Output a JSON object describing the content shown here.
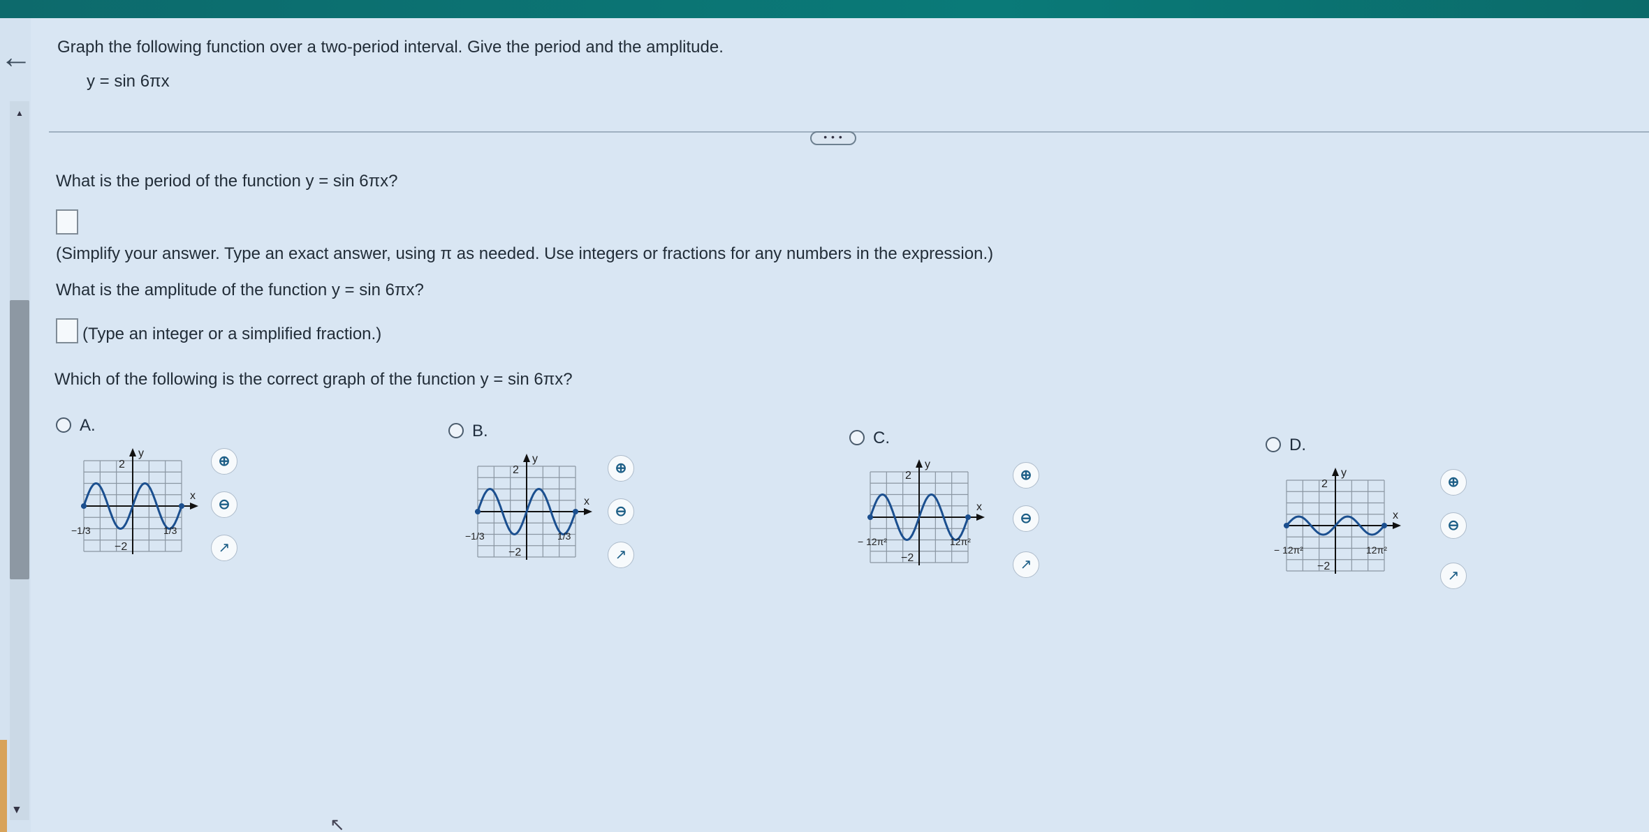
{
  "problem": {
    "prompt": "Graph the following function over a two-period interval. Give the period and the amplitude.",
    "function": "y = sin 6πx"
  },
  "more_pill": "• • •",
  "questions": {
    "period": "What is the period of the function y = sin 6πx?",
    "period_hint": "(Simplify your answer. Type an exact answer, using π as needed. Use integers or fractions for any numbers in the expression.)",
    "amplitude": "What is the amplitude of the function y = sin 6πx?",
    "amplitude_hint": "(Type an integer or a simplified fraction.)",
    "graph": "Which of the following is the correct graph of the function y = sin 6πx?"
  },
  "answers": {
    "period_value": "",
    "amplitude_value": ""
  },
  "options": [
    {
      "label": "A.",
      "xmin_label": "−1/3",
      "xmax_label": "1/3",
      "ymax_label": "2",
      "ymin_label": "−2",
      "x_axis": "x",
      "y_axis": "y"
    },
    {
      "label": "B.",
      "xmin_label": "−1/3",
      "xmax_label": "1/3",
      "ymax_label": "2",
      "ymin_label": "−2",
      "x_axis": "x",
      "y_axis": "y"
    },
    {
      "label": "C.",
      "xmin_label": "− 12π²",
      "xmax_label": "12π²",
      "ymax_label": "2",
      "ymin_label": "−2",
      "x_axis": "x",
      "y_axis": "y"
    },
    {
      "label": "D.",
      "xmin_label": "− 12π²",
      "xmax_label": "12π²",
      "ymax_label": "2",
      "ymin_label": "−2",
      "x_axis": "x",
      "y_axis": "y"
    }
  ],
  "icons": {
    "zoom_in": "zoom-in-icon",
    "zoom_out": "zoom-out-icon",
    "external": "external-link-icon",
    "back": "back-arrow-icon"
  },
  "colors": {
    "top_bar": "#0d6a6c",
    "curve": "#1b4f8f",
    "accent": "#1c5e86"
  }
}
